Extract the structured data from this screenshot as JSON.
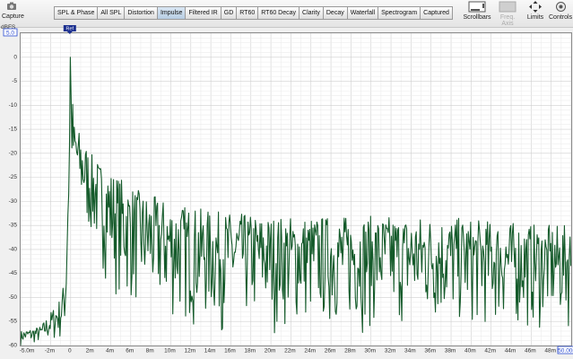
{
  "toolbar": {
    "capture_label": "Capture",
    "scrollbars_label": "Scrollbars",
    "freq_axis_label": "Freq. Axis",
    "limits_label": "Limits",
    "controls_label": "Controls",
    "tabs": [
      "SPL & Phase",
      "All SPL",
      "Distortion",
      "Impulse",
      "Filtered IR",
      "GD",
      "RT60",
      "RT60 Decay",
      "Clarity",
      "Decay",
      "Waterfall",
      "Spectrogram",
      "Captured"
    ],
    "active_tab": "Impulse"
  },
  "plot": {
    "y_unit": "dBFS",
    "y_top_box": "5.0",
    "x_end_box": "50.00m",
    "ref_label": "Ref"
  },
  "colors": {
    "trace": "#145a2a",
    "grid": "#d6d6d6",
    "active_tab": "#c3d6ea"
  },
  "chart_data": {
    "type": "line",
    "xlabel": "",
    "ylabel": "dBFS",
    "xlim_ms": [
      -5,
      50
    ],
    "ylim_db": [
      -60,
      5
    ],
    "x_tick_labels": [
      "-5.0m",
      "-2m",
      "0",
      "2m",
      "4m",
      "6m",
      "8m",
      "10m",
      "12m",
      "14m",
      "16m",
      "18m",
      "20m",
      "22m",
      "24m",
      "26m",
      "28m",
      "30m",
      "32m",
      "34m",
      "36m",
      "38m",
      "40m",
      "42m",
      "44m",
      "46m",
      "48m",
      "50.00m"
    ],
    "y_tick_labels": [
      "5.0",
      "0",
      "-5",
      "-10",
      "-15",
      "-20",
      "-25",
      "-30",
      "-35",
      "-40",
      "-45",
      "-50",
      "-55",
      "-60"
    ],
    "series": [
      {
        "color": "#145a2a",
        "envelope": {
          "x_ms": [
            -5,
            -3,
            -1,
            -0.5,
            0,
            0.3,
            0.6,
            1,
            2,
            3,
            5,
            7,
            10,
            14,
            20,
            26,
            30,
            36,
            42,
            48,
            50
          ],
          "peak_db": [
            -57,
            -56,
            -50,
            -45,
            0,
            -13,
            -14,
            -16,
            -20,
            -22,
            -25,
            -28,
            -30,
            -32,
            -33,
            -33,
            -33,
            -33,
            -34,
            -35,
            -35
          ],
          "floor_db": [
            -60,
            -60,
            -60,
            -58,
            -30,
            -30,
            -33,
            -35,
            -40,
            -45,
            -52,
            -55,
            -57,
            -58,
            -58,
            -58,
            -58,
            -58,
            -58,
            -58,
            -58
          ]
        }
      }
    ]
  }
}
